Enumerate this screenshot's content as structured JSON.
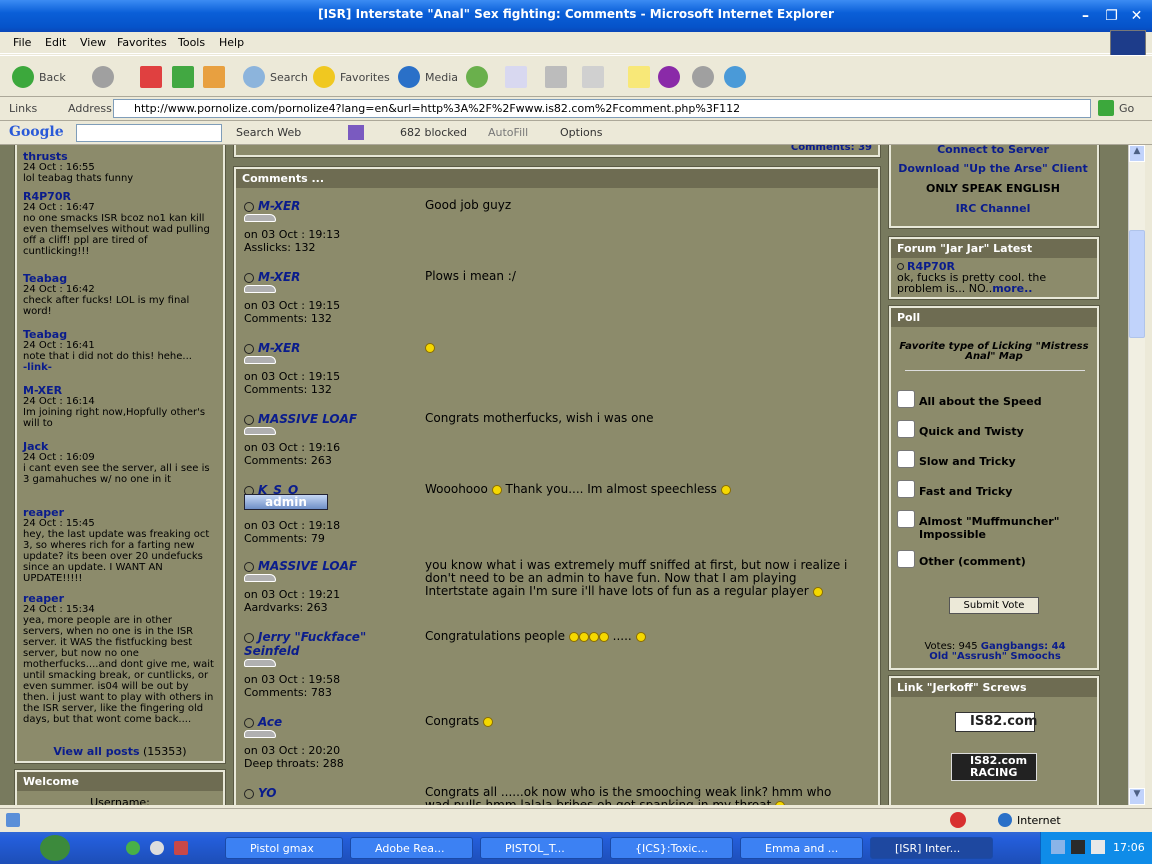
{
  "window": {
    "title": "[ISR] Interstate \"Anal\" Sex fighting: Comments - Microsoft Internet Explorer"
  },
  "menu": [
    "File",
    "Edit",
    "View",
    "Favorites",
    "Tools",
    "Help"
  ],
  "toolbar": {
    "back": "Back",
    "search": "Search",
    "favorites": "Favorites",
    "media": "Media"
  },
  "address": {
    "links": "Links",
    "label": "Address",
    "url": "http://www.pornolize.com/pornolize4?lang=en&url=http%3A%2F%2Fwww.is82.com%2Fcomment.php%3F112",
    "go": "Go"
  },
  "googlebar": {
    "logo": "Google",
    "searchweb": "Search Web",
    "blocked": "682 blocked",
    "autofill": "AutoFill",
    "options": "Options"
  },
  "shoutbox": {
    "entries": [
      {
        "user": "thrusts",
        "date": "24 Oct : 16:55",
        "text": "lol teabag thats funny"
      },
      {
        "user": "R4P70R",
        "date": "24 Oct : 16:47",
        "text": "no one smacks ISR bcoz no1 kan kill even themselves without wad pulling off a cliff! ppl are tired of cuntlicking!!!"
      },
      {
        "user": "Teabag",
        "date": "24 Oct : 16:42",
        "text": "check after fucks! LOL is my final word!"
      },
      {
        "user": "Teabag",
        "date": "24 Oct : 16:41",
        "text": "note that i did not do this! hehe...",
        "link": "-link-"
      },
      {
        "user": "M-XER",
        "date": "24 Oct : 16:14",
        "text": "Im joining right now,Hopfully other's will to"
      },
      {
        "user": "Jack",
        "date": "24 Oct : 16:09",
        "text": "i cant even see the server, all i see is 3 gamahuches w/ no one in it"
      },
      {
        "user": "reaper",
        "date": "24 Oct : 15:45",
        "text": "hey, the last update was freaking oct 3, so wheres rich for a farting new update? its been over 20 undefucks since an update. I WANT AN UPDATE!!!!!"
      },
      {
        "user": "reaper",
        "date": "24 Oct : 15:34",
        "text": "yea, more people are in other servers, when no one is in the ISR server. it WAS the fistfucking best server, but now no one motherfucks....and dont give me, wait until smacking break, or cuntlicks, or even summer. is04 will be out by then. i just want to play with others in the ISR server, like the fingering old days, but that wont come back...."
      }
    ],
    "view_all": "View all posts",
    "view_all_count": "(15353)"
  },
  "welcome": {
    "title": "Welcome",
    "username": "Username:"
  },
  "comments": {
    "count_label": "Comments: 39",
    "header": "Comments ...",
    "items": [
      {
        "name": "M-XER",
        "date": "on 03 Oct : 19:13",
        "stat": "Asslicks: 132",
        "text": "Good job guyz"
      },
      {
        "name": "M-XER",
        "date": "on 03 Oct : 19:15",
        "stat": "Comments: 132",
        "text": "Plows i mean :/"
      },
      {
        "name": "M-XER",
        "date": "on 03 Oct : 19:15",
        "stat": "Comments: 132",
        "text": ""
      },
      {
        "name": "MASSIVE LOAF",
        "date": "on 03 Oct : 19:16",
        "stat": "Comments: 263",
        "text": "Congrats motherfucks, wish i was one"
      },
      {
        "name": "K_S_O",
        "badge": "admin",
        "date": "on 03 Oct : 19:18",
        "stat": "Comments: 79",
        "text": "Wooohooo",
        "text2": "Thank you.... Im almost speechless"
      },
      {
        "name": "MASSIVE LOAF",
        "date": "on 03 Oct : 19:21",
        "stat": "Aardvarks: 263",
        "text": "you know what i was extremely muff sniffed at first, but now i realize i don't need to be an admin to have fun. Now that I am playing Intertstate again I'm sure i'll have lots of fun as a regular player"
      },
      {
        "name": "Jerry \"Fuckface\" Seinfeld",
        "date": "on 03 Oct : 19:58",
        "stat": "Comments: 783",
        "text": "Congratulations people",
        "text2": "....."
      },
      {
        "name": "Ace",
        "date": "on 03 Oct : 20:20",
        "stat": "Deep throats: 288",
        "text": "Congrats"
      },
      {
        "name": "YO",
        "date": "",
        "stat": "",
        "text": "Congrats all ......ok now who is the smooching weak link? hmm who wad pulls hmm lalala bribes oh got spanking in my throat"
      }
    ]
  },
  "right": {
    "connect": "Connect to Server",
    "download": "Download \"Up the Arse\" Client",
    "english": "ONLY SPEAK ENGLISH",
    "irc": "IRC Channel",
    "forum_title": "Forum \"Jar Jar\" Latest",
    "forum_user": "R4P70R",
    "forum_text": "ok, fucks is pretty cool. the problem is... NO..",
    "forum_more": "more..",
    "poll_title": "Poll",
    "poll_question": "Favorite type of Licking \"Mistress Anal\" Map",
    "poll_options": [
      "All about the Speed",
      "Quick and Twisty",
      "Slow and Tricky",
      "Fast and Tricky",
      "Almost \"Muffmuncher\" Impossible",
      "Other (comment)"
    ],
    "submit": "Submit Vote",
    "votes_a": "Votes: 945",
    "votes_b": "Gangbangs: 44",
    "votes_c": "Old \"Assrush\" Smoochs",
    "links_title": "Link \"Jerkoff\" Screws",
    "logo1": "IS82.com",
    "logo2a": "IS82.com",
    "logo2b": "RACING"
  },
  "status": {
    "zone": "Internet"
  },
  "taskbar": {
    "tasks": [
      "Pistol gmax",
      "Adobe Rea...",
      "PISTOL_T...",
      "{ICS}:Toxic...",
      "Emma and ...",
      "[ISR] Inter..."
    ],
    "clock": "17:06"
  }
}
